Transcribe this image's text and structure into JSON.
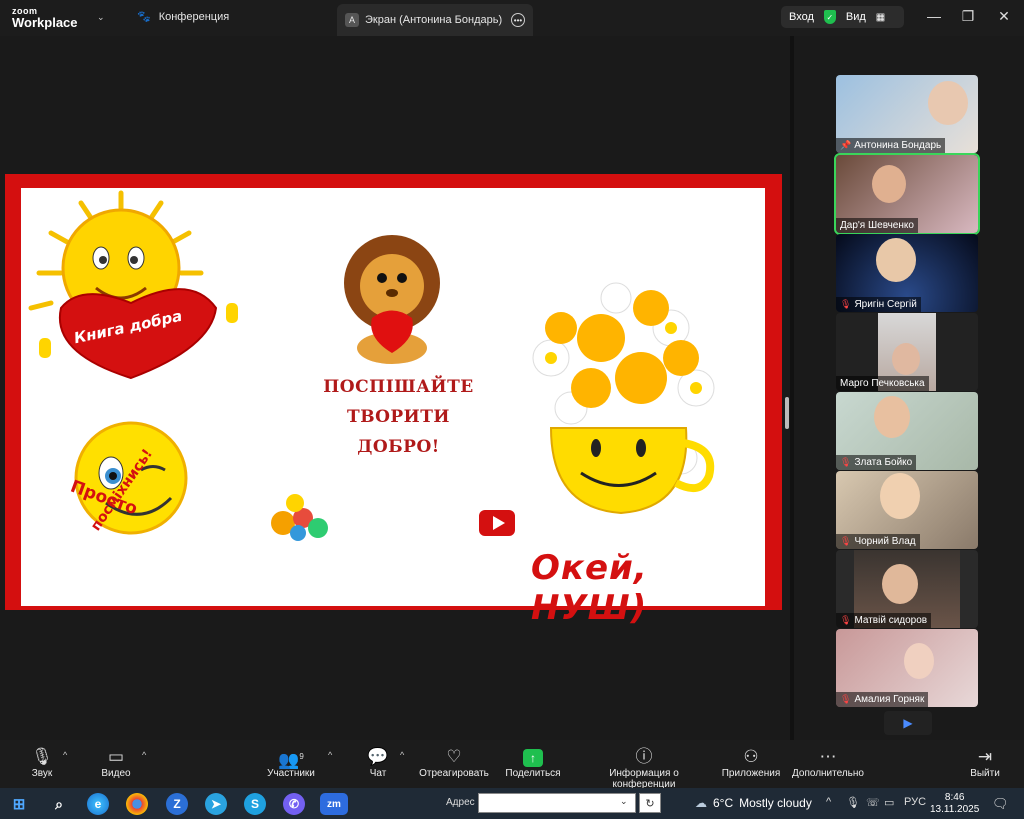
{
  "app": {
    "logo_top": "zoom",
    "logo_bottom": "Workplace"
  },
  "tabs": {
    "conference": "Конференция",
    "screen_badge": "A",
    "screen": "Экран (Антонина Бондарь)"
  },
  "header": {
    "login": "Вход",
    "view": "Вид"
  },
  "slide": {
    "book_label": "Книга добра",
    "prosto_label_1": "Просто",
    "prosto_label_2": "посміхнись!",
    "line1": "ПОСПІШАЙТЕ",
    "line2": "ТВОРИТИ",
    "line3": "ДОБРО!",
    "okei": "Окей, НУШ)"
  },
  "participants": [
    {
      "name": "Антонина Бондарь",
      "muted": false,
      "pinned": true
    },
    {
      "name": "Дар'я Шевченко",
      "muted": false,
      "pinned": false,
      "active": true
    },
    {
      "name": "Яригін Сергій",
      "muted": true,
      "pinned": false
    },
    {
      "name": "Марго Печковська",
      "muted": false,
      "pinned": false
    },
    {
      "name": "Злата Бойко",
      "muted": true,
      "pinned": false
    },
    {
      "name": "Чорний Влад",
      "muted": true,
      "pinned": false
    },
    {
      "name": "Матвій сидоров",
      "muted": true,
      "pinned": false
    },
    {
      "name": "Амалия Горняк",
      "muted": true,
      "pinned": false
    }
  ],
  "toolbar": {
    "audio": "Звук",
    "video": "Видео",
    "participants": "Участники",
    "participants_count": "9",
    "chat": "Чат",
    "react": "Отреагировать",
    "share": "Поделиться",
    "info": "Информация о конференции",
    "apps": "Приложения",
    "more": "Дополнительно",
    "leave": "Выйти"
  },
  "taskbar": {
    "address_label": "Адрес",
    "temperature": "6°C",
    "weather": "Mostly cloudy",
    "lang": "РУС",
    "time": "8:46",
    "date": "13.11.2025"
  },
  "colors": {
    "active_border": "#3ad55a",
    "share_green": "#1fbf4f",
    "slide_red": "#d40f0f"
  }
}
